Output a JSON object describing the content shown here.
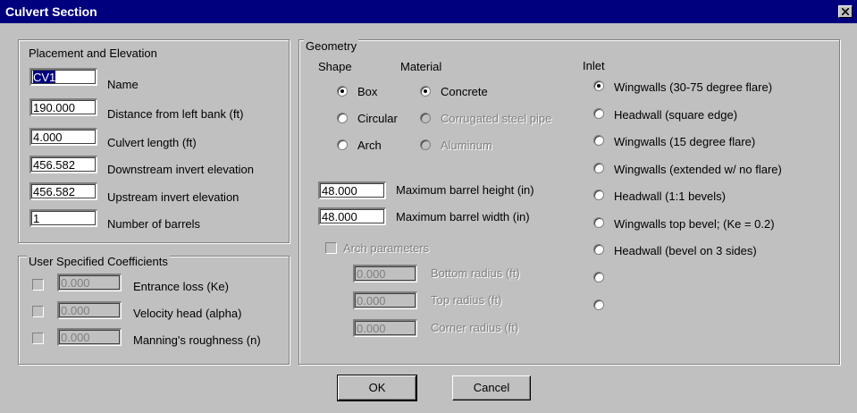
{
  "window": {
    "title": "Culvert Section"
  },
  "placement": {
    "title": "Placement and Elevation",
    "fields": [
      {
        "value": "CV1",
        "label": "Name"
      },
      {
        "value": "190.000",
        "label": "Distance from left bank (ft)"
      },
      {
        "value": "4.000",
        "label": "Culvert length (ft)"
      },
      {
        "value": "456.582",
        "label": "Downstream invert elevation"
      },
      {
        "value": "456.582",
        "label": "Upstream invert elevation"
      },
      {
        "value": "1",
        "label": "Number of barrels"
      }
    ]
  },
  "coefficients": {
    "title": "User Specified Coefficients",
    "rows": [
      {
        "value": "0.000",
        "label": "Entrance loss (Ke)",
        "checked": false
      },
      {
        "value": "0.000",
        "label": "Velocity head (alpha)",
        "checked": false
      },
      {
        "value": "0.000",
        "label": "Manning's roughness (n)",
        "checked": false
      }
    ]
  },
  "geometry": {
    "title": "Geometry",
    "shape": {
      "title": "Shape",
      "options": [
        "Box",
        "Circular",
        "Arch"
      ],
      "selected": "Box"
    },
    "material": {
      "title": "Material",
      "options": [
        "Concrete",
        "Corrugated steel pipe",
        "Aluminum"
      ],
      "selected": "Concrete"
    },
    "barrel": [
      {
        "value": "48.000",
        "label": "Maximum barrel height (in)"
      },
      {
        "value": "48.000",
        "label": "Maximum barrel width (in)"
      }
    ],
    "arch": {
      "label": "Arch parameters",
      "checked": false,
      "params": [
        {
          "value": "0.000",
          "label": "Bottom radius (ft)"
        },
        {
          "value": "0.000",
          "label": "Top radius (ft)"
        },
        {
          "value": "0.000",
          "label": "Corner radius (ft)"
        }
      ]
    },
    "inlet": {
      "title": "Inlet",
      "options": [
        "Wingwalls (30-75 degree flare)",
        "Headwall (square edge)",
        "Wingwalls (15 degree flare)",
        "Wingwalls (extended w/ no flare)",
        "Headwall (1:1 bevels)",
        "Wingwalls top bevel; (Ke = 0.2)",
        "Headwall (bevel on 3 sides)",
        "",
        ""
      ],
      "selected_index": 0
    }
  },
  "buttons": {
    "ok": "OK",
    "cancel": "Cancel"
  },
  "colors": {
    "titlebar": "#00007f",
    "face": "#c0c0c0",
    "disabled_text": "#808080"
  }
}
